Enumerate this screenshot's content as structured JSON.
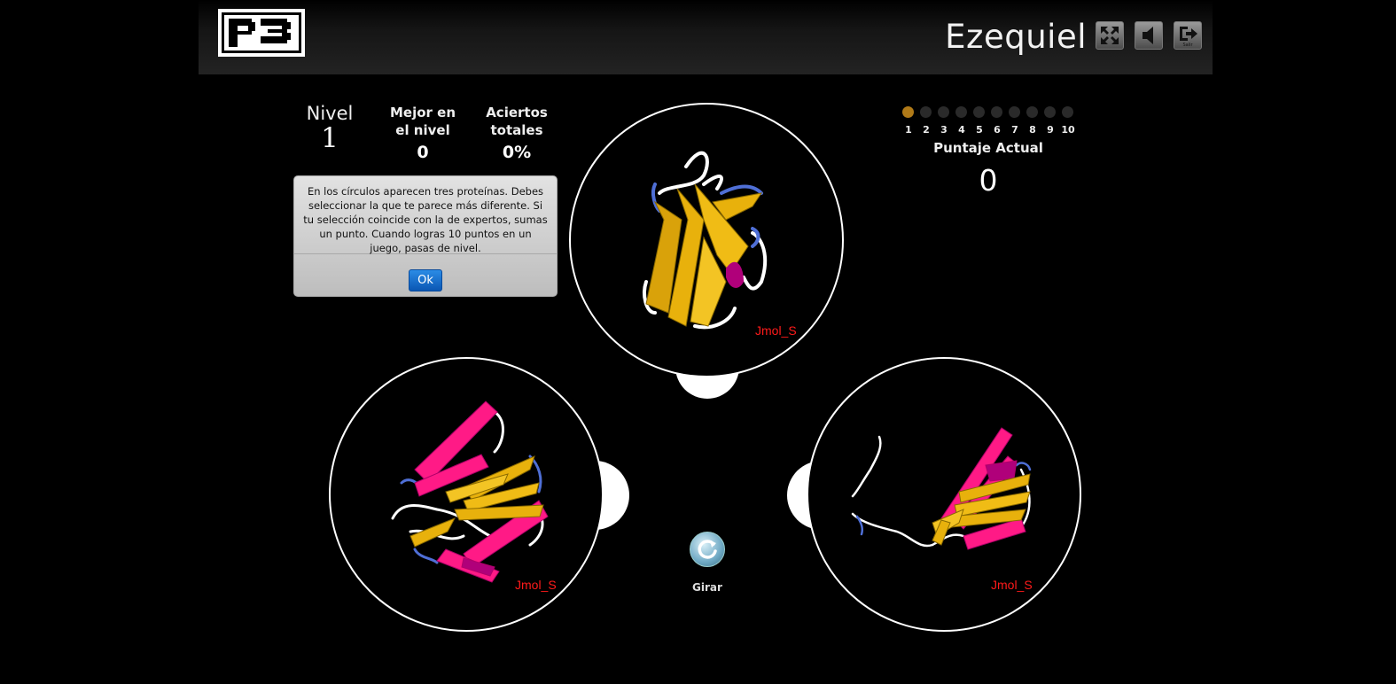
{
  "header": {
    "logo_text": "P3",
    "username": "Ezequiel",
    "exit_caption": "Salir"
  },
  "stats": {
    "level_label": "Nivel",
    "level_value": "1",
    "best_label": "Mejor en el nivel",
    "best_value": "0",
    "hits_label": "Aciertos totales",
    "hits_value": "0%"
  },
  "dialog": {
    "message": "En los círculos aparecen tres proteínas. Debes seleccionar la que te parece más diferente. Si tu selección coincide con la de expertos, sumas un punto. Cuando logras 10 puntos en un juego, pasas de nivel.",
    "ok_label": "Ok"
  },
  "progress": {
    "current": 1,
    "labels": [
      "1",
      "2",
      "3",
      "4",
      "5",
      "6",
      "7",
      "8",
      "9",
      "10"
    ]
  },
  "score": {
    "label": "Puntaje Actual",
    "value": "0"
  },
  "proteins": [
    {
      "label": "Jmol_S"
    },
    {
      "label": "Jmol_S"
    },
    {
      "label": "Jmol_S"
    }
  ],
  "rotate": {
    "label": "Girar"
  },
  "colors": {
    "background": "#000000",
    "strand": "#e8b10c",
    "helix": "#ff1a86",
    "turn": "#4f6fd6",
    "coil": "#ffffff",
    "jmol_label": "#ff1a1a",
    "dot_active": "#b07a18",
    "dot_inactive": "#2a2a2a",
    "ok_button": "#0a63c9"
  }
}
